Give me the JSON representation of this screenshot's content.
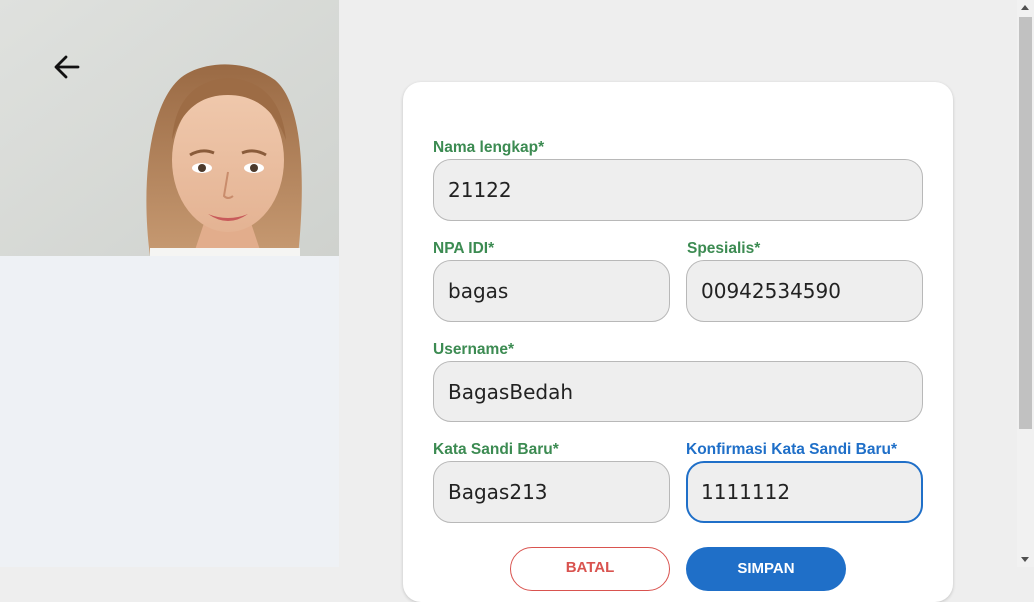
{
  "header": {
    "back_icon": "arrow-left-icon"
  },
  "form": {
    "full_name": {
      "label": "Nama lengkap*",
      "value": "21122"
    },
    "npa_idi": {
      "label": "NPA IDI*",
      "value": "bagas"
    },
    "specialist": {
      "label": "Spesialis*",
      "value": "00942534590"
    },
    "username": {
      "label": "Username*",
      "value": "BagasBedah"
    },
    "new_password": {
      "label": "Kata Sandi Baru*",
      "value": "Bagas213"
    },
    "confirm_password": {
      "label": "Konfirmasi Kata Sandi Baru*",
      "value": "1111112"
    }
  },
  "buttons": {
    "cancel_label": "BATAL",
    "save_label": "SIMPAN"
  },
  "colors": {
    "label_green": "#3c8b52",
    "focus_blue": "#1f6fc8",
    "cancel_red": "#d9534f"
  }
}
